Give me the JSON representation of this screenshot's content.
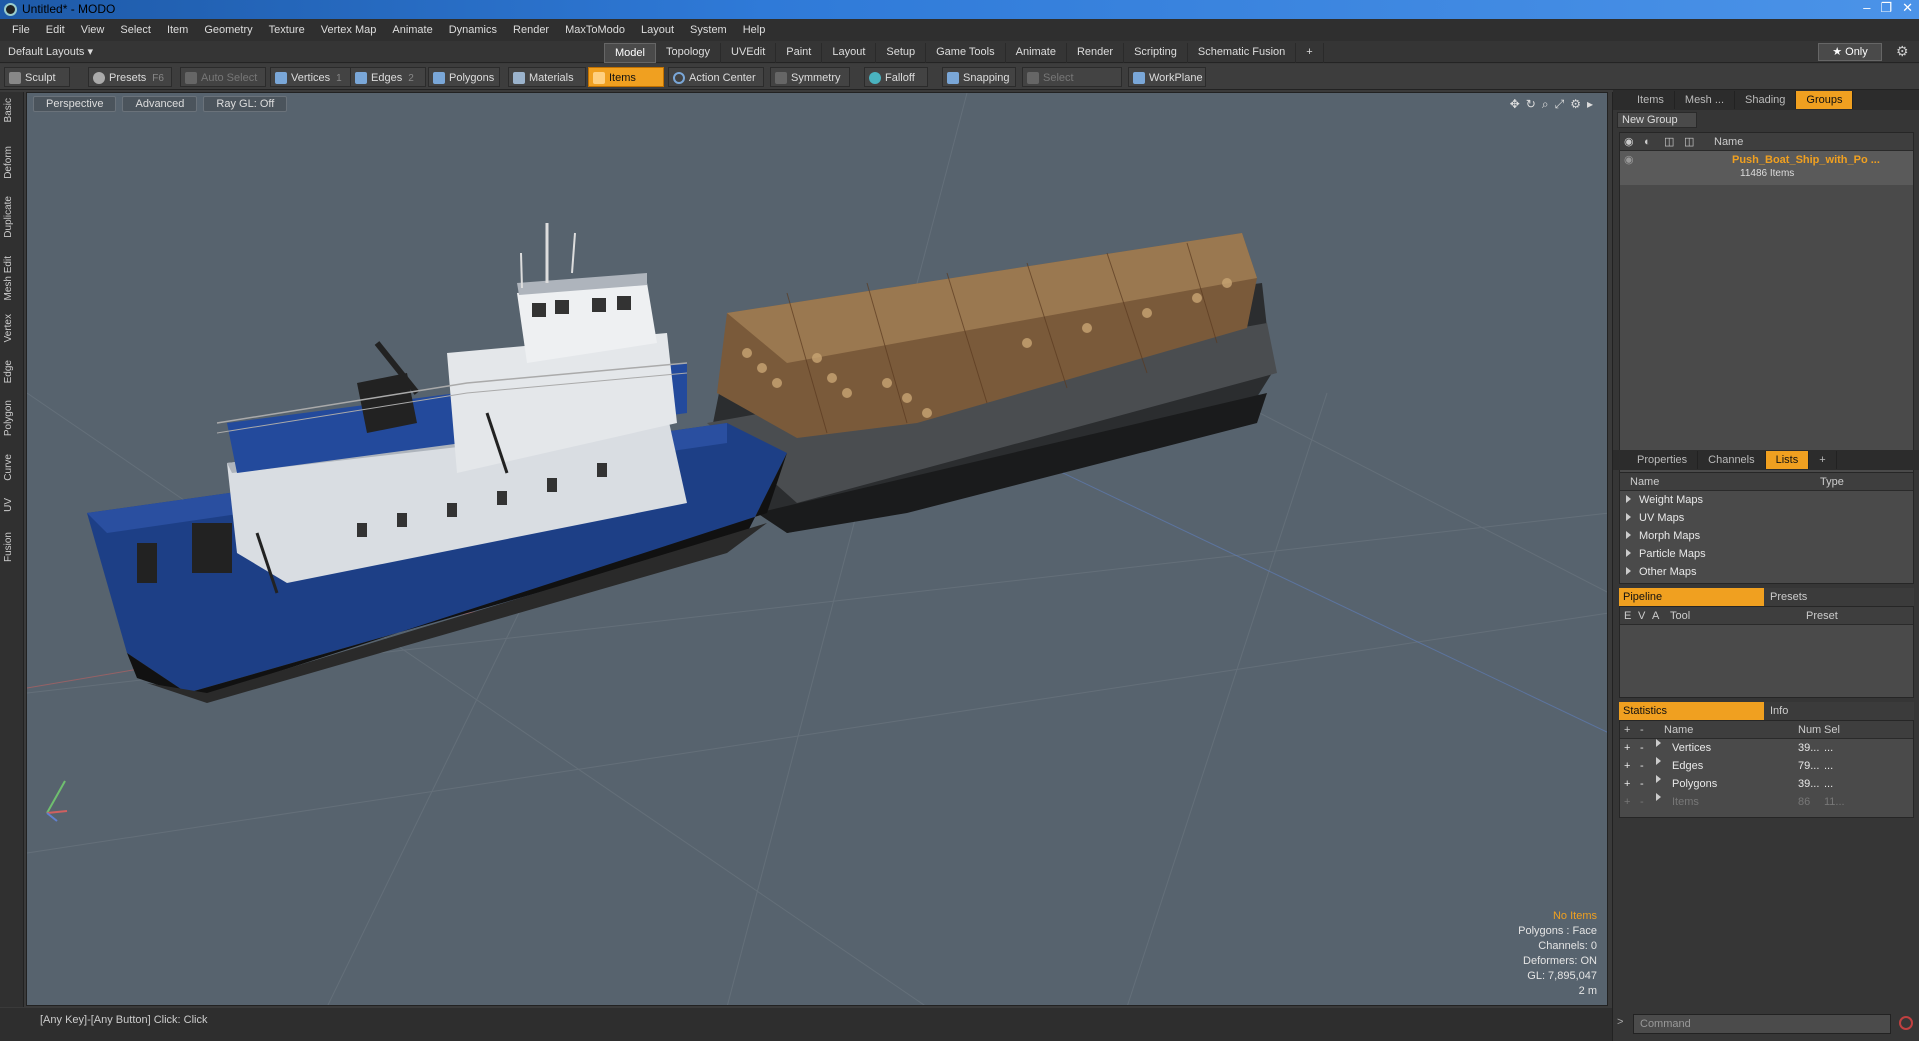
{
  "window": {
    "title": "Untitled* - MODO"
  },
  "menu": [
    "File",
    "Edit",
    "View",
    "Select",
    "Item",
    "Geometry",
    "Texture",
    "Vertex Map",
    "Animate",
    "Dynamics",
    "Render",
    "MaxToModo",
    "Layout",
    "System",
    "Help"
  ],
  "layout": {
    "preset": "Default Layouts ▾",
    "tabs": [
      "Model",
      "Topology",
      "UVEdit",
      "Paint",
      "Layout",
      "Setup",
      "Game Tools",
      "Animate",
      "Render",
      "Scripting",
      "Schematic Fusion",
      "+"
    ],
    "active_tab": "Model",
    "only_label": "★ Only"
  },
  "toolbar": {
    "sculpt": "Sculpt",
    "presets": "Presets",
    "presets_key": "F6",
    "auto_select": "Auto Select",
    "vertices": "Vertices",
    "vertices_count": "1",
    "edges": "Edges",
    "edges_count": "2",
    "polygons": "Polygons",
    "materials": "Materials",
    "items": "Items",
    "action_center": "Action Center",
    "symmetry": "Symmetry",
    "falloff": "Falloff",
    "snapping": "Snapping",
    "select_through": "Select Through",
    "workplane": "WorkPlane"
  },
  "left_tabs": [
    "Basic",
    "Deform",
    "Duplicate",
    "Mesh Edit",
    "Vertex",
    "Edge",
    "Polygon",
    "Curve",
    "UV",
    "Fusion"
  ],
  "viewport": {
    "view": "Perspective",
    "shading": "Advanced",
    "raygl": "Ray GL: Off",
    "stats": {
      "selection": "No Items",
      "polygons": "Polygons : Face",
      "channels": "Channels: 0",
      "deformers": "Deformers: ON",
      "gl": "GL: 7,895,047",
      "scale": "2 m"
    }
  },
  "status": "[Any Key]-[Any Button] Click:  Click",
  "groups_panel": {
    "tabs": [
      "Items",
      "Mesh ...",
      "Shading",
      "Groups"
    ],
    "active_tab": "Groups",
    "new_group": "New Group",
    "col_name": "Name",
    "group_name": "Push_Boat_Ship_with_Po ...",
    "group_items": "11486 Items"
  },
  "lists_panel": {
    "tabs": [
      "Properties",
      "Channels",
      "Lists",
      "+"
    ],
    "active_tab": "Lists",
    "col_name": "Name",
    "col_type": "Type",
    "rows": [
      "Weight Maps",
      "UV Maps",
      "Morph Maps",
      "Particle Maps",
      "Other Maps"
    ]
  },
  "pipeline_panel": {
    "tab_on": "Pipeline",
    "tab_off": "Presets",
    "cols": [
      "E",
      "V",
      "A",
      "Tool",
      "Preset"
    ]
  },
  "stats_panel": {
    "tab_on": "Statistics",
    "tab_off": "Info",
    "col_name": "Name",
    "col_num": "Num",
    "col_sel": "Sel",
    "rows": [
      {
        "name": "Vertices",
        "num": "39...",
        "sel": "..."
      },
      {
        "name": "Edges",
        "num": "79...",
        "sel": "..."
      },
      {
        "name": "Polygons",
        "num": "39...",
        "sel": "..."
      },
      {
        "name": "Items",
        "num": "86",
        "sel": "11..."
      }
    ]
  },
  "command": {
    "placeholder": "Command"
  },
  "colors": {
    "accent": "#f0a020",
    "viewport_bg": "#57636e",
    "hull_blue": "#1d3f86"
  }
}
